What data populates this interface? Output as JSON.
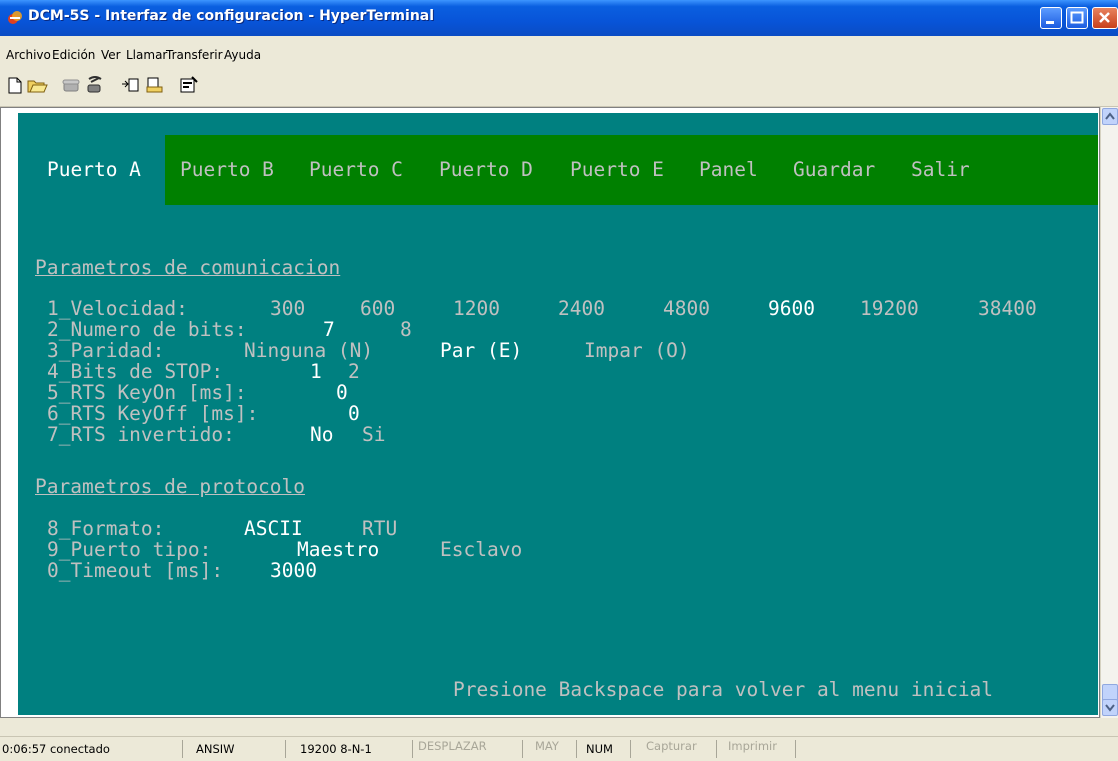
{
  "window": {
    "title": "DCM-5S - Interfaz de configuracion - HyperTerminal"
  },
  "menubar": {
    "items": [
      "Archivo",
      "Edición",
      "Ver",
      "Llamar",
      "Transferir",
      "Ayuda"
    ]
  },
  "toolbar": {
    "icons": [
      "new-file-icon",
      "open-folder-icon",
      "phone-icon",
      "disconnect-icon",
      "send-icon",
      "receive-icon",
      "properties-icon"
    ]
  },
  "terminal": {
    "tabs": [
      "Puerto A",
      "Puerto B",
      "Puerto C",
      "Puerto D",
      "Puerto E",
      "Panel",
      "Guardar",
      "Salir"
    ],
    "section1": "Parametros de comunicacion",
    "velocidad": {
      "label": "1_Velocidad:",
      "options": [
        "300",
        "600",
        "1200",
        "2400",
        "4800",
        "9600",
        "19200",
        "38400"
      ],
      "selected": "9600"
    },
    "bits": {
      "label": "2_Numero de bits:",
      "options": [
        "7",
        "8"
      ],
      "selected": "7"
    },
    "paridad": {
      "label": "3_Paridad:",
      "options": [
        "Ninguna (N)",
        "Par (E)",
        "Impar (O)"
      ],
      "selected": "Par (E)"
    },
    "stop": {
      "label": "4_Bits de STOP:",
      "options": [
        "1",
        "2"
      ],
      "selected": "1"
    },
    "keyon": {
      "label": "5_RTS KeyOn [ms]:",
      "value": "0"
    },
    "keyoff": {
      "label": "6_RTS KeyOff [ms]:",
      "value": "0"
    },
    "rtsinv": {
      "label": "7_RTS invertido:",
      "options": [
        "No",
        "Si"
      ],
      "selected": "No"
    },
    "section2": "Parametros de protocolo",
    "formato": {
      "label": "8_Formato:",
      "options": [
        "ASCII",
        "RTU"
      ],
      "selected": "ASCII"
    },
    "puertotipo": {
      "label": "9_Puerto tipo:",
      "options": [
        "Maestro",
        "Esclavo"
      ],
      "selected": "Maestro"
    },
    "timeout": {
      "label": "0_Timeout [ms]:",
      "value": "3000"
    },
    "footer": "Presione Backspace para volver al menu inicial"
  },
  "statusbar": {
    "connected": "0:06:57 conectado",
    "emulation": "ANSIW",
    "settings": "19200 8-N-1",
    "scroll": "DESPLAZAR",
    "caps": "MAY",
    "num": "NUM",
    "capture": "Capturar",
    "print": "Imprimir"
  }
}
